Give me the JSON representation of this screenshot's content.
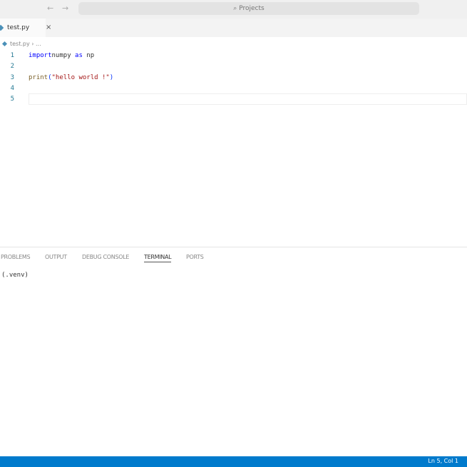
{
  "titlebar": {
    "back": "←",
    "forward": "→",
    "search": "⌕ Projects"
  },
  "tabs": [
    {
      "label": "test.py",
      "close": "×"
    }
  ],
  "breadcrumb": "test.py › ...",
  "editor": {
    "lines": [
      {
        "n": "1",
        "tokens": [
          [
            "kw",
            "import"
          ],
          [
            "",
            "numpy "
          ],
          [
            "kw",
            "as"
          ],
          [
            "",
            " np"
          ]
        ]
      },
      {
        "n": "2",
        "tokens": []
      },
      {
        "n": "3",
        "tokens": [
          [
            "fn",
            "print"
          ],
          [
            "br",
            "("
          ],
          [
            "str",
            "\"hello world !\""
          ],
          [
            "br",
            ")"
          ]
        ]
      },
      {
        "n": "4",
        "tokens": []
      },
      {
        "n": "5",
        "tokens": []
      }
    ]
  },
  "panel": {
    "tabs": [
      "PROBLEMS",
      "OUTPUT",
      "DEBUG CONSOLE",
      "TERMINAL",
      "PORTS"
    ],
    "active": "TERMINAL",
    "terminal": "(.venv)"
  },
  "status": {
    "position": "Ln 5, Col 1"
  },
  "colors": {
    "status_bar": "#007acc",
    "keyword": "#0000ff",
    "string": "#a31515"
  }
}
